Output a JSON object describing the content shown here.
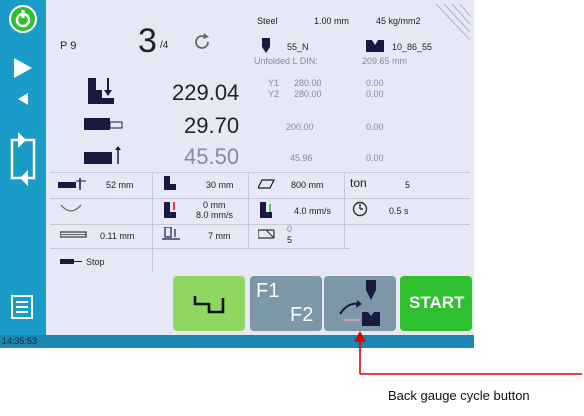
{
  "status": {
    "time": "14:35:53"
  },
  "program": {
    "label": "P 9",
    "step_current": "3",
    "step_total": "/4"
  },
  "material": {
    "name": "Steel",
    "thickness": "1.00 mm",
    "strength": "45 kg/mm2"
  },
  "tooling": {
    "punch": "55_N",
    "die": "10_86_55",
    "unfolded_label": "Unfolded L DIN:",
    "unfolded_value": "209.65 mm"
  },
  "axes": {
    "y1_label": "Y1",
    "y1_value": "280.00",
    "y1_extra": "0.00",
    "y2_label": "Y2",
    "y2_value": "280.00",
    "y2_extra": "0.00",
    "y_main": "229.04",
    "x_main": "29.70",
    "x_ref": "200.00",
    "x_extra": "0.00",
    "r_main": "45.50",
    "r_ref": "45.96",
    "r_extra": "0.00"
  },
  "params": {
    "p1": "52 mm",
    "p2": "30 mm",
    "p3": "800 mm",
    "ton_label": "ton",
    "ton_value": "5",
    "p5_a": "0 mm",
    "p5_b": "8.0 mm/s",
    "p6": "4.0 mm/s",
    "p7": "0.5 s",
    "p8": "0.11 mm",
    "p9": "7 mm",
    "p10_a": "0",
    "p10_b": "5",
    "stop_label": "Stop"
  },
  "buttons": {
    "f1": "F1",
    "f2": "F2",
    "start": "START"
  },
  "annotation": {
    "caption": "Back gauge cycle button"
  },
  "colors": {
    "sidebar": "#1a9bc8",
    "green": "#2ec02e",
    "light_green": "#8fd860",
    "grey_btn": "#7c97a8",
    "arrow": "#e00000"
  }
}
